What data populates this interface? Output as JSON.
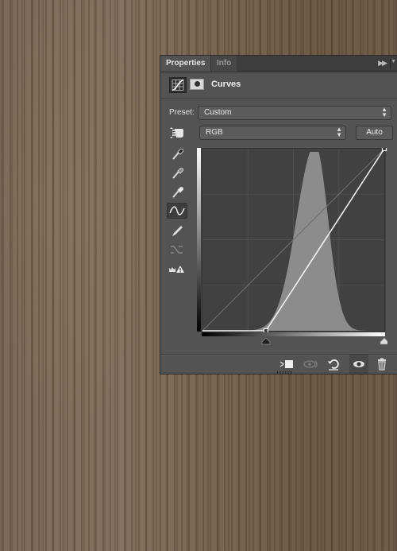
{
  "panel": {
    "tabs": [
      {
        "label": "Properties",
        "active": true
      },
      {
        "label": "Info",
        "active": false
      }
    ],
    "menu_icon": "double-chevron-right-icon",
    "header": {
      "icons": [
        "curves-adjustment-icon",
        "layer-mask-icon"
      ],
      "title": "Curves"
    },
    "preset": {
      "label": "Preset:",
      "value": "Custom"
    },
    "channel": {
      "value": "RGB"
    },
    "auto_label": "Auto",
    "tools": [
      {
        "icon": "sample-black-point-eyedropper-icon",
        "selected": false
      },
      {
        "icon": "sample-gray-point-eyedropper-icon",
        "selected": false
      },
      {
        "icon": "sample-white-point-eyedropper-icon",
        "selected": false
      },
      {
        "icon": "edit-points-curve-icon",
        "selected": true
      },
      {
        "icon": "draw-pencil-icon",
        "selected": false
      },
      {
        "icon": "smooth-curve-icon",
        "selected": false,
        "disabled": true
      },
      {
        "icon": "clipping-warning-icon",
        "selected": false
      }
    ],
    "curve": {
      "input_range": [
        0,
        255
      ],
      "output_range": [
        0,
        255
      ],
      "points": [
        [
          89,
          0
        ],
        [
          255,
          255
        ]
      ],
      "black_slider_input": 89,
      "white_slider_input": 255,
      "histogram_peak_input": 158
    },
    "footer_icons": [
      {
        "icon": "clip-to-layer-icon",
        "enabled": true
      },
      {
        "icon": "view-previous-state-icon",
        "enabled": false
      },
      {
        "icon": "reset-icon",
        "enabled": true
      },
      {
        "icon": "toggle-visibility-eye-icon",
        "enabled": true,
        "active": true
      },
      {
        "icon": "delete-trash-icon",
        "enabled": true
      }
    ]
  }
}
